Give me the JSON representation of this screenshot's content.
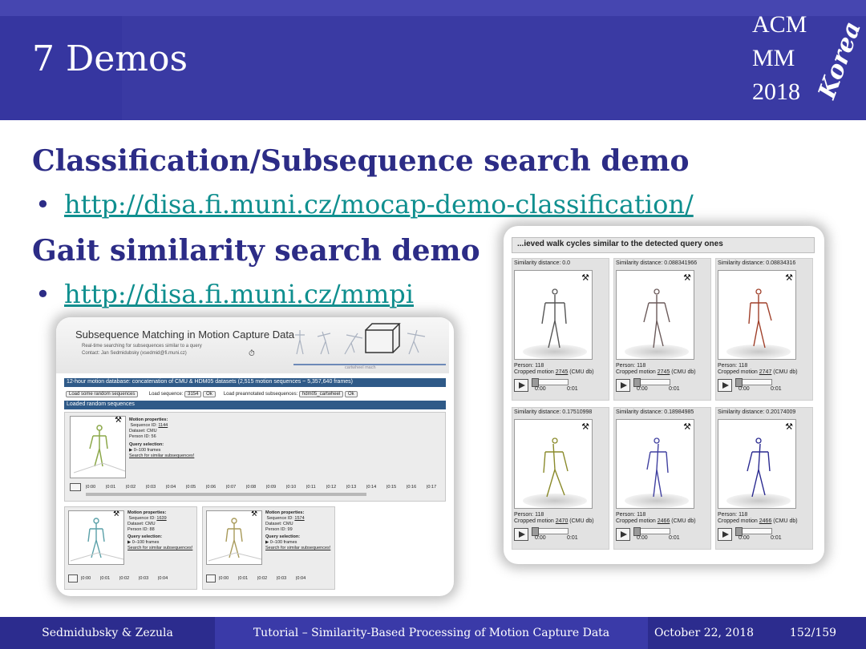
{
  "slide": {
    "title": "7 Demos",
    "logo": {
      "line1": "ACM",
      "line2": "MM",
      "line3": "2018",
      "script": "Korea"
    },
    "section1": {
      "heading": "Classification/Subsequence search demo",
      "link": "http://disa.fi.muni.cz/mocap-demo-classification/"
    },
    "section2": {
      "heading": "Gait similarity search demo",
      "link": "http://disa.fi.muni.cz/mmpi"
    }
  },
  "left_shot": {
    "title": "Subsequence Matching in Motion Capture Data",
    "subtitle": "Real-time searching for subsequences similar to a query",
    "contact": "Contact: Jan Sedmidubsky (xsedmid@fi.muni.cz)",
    "timeline_label": "cartwheel mach",
    "db_bar": "12-hour motion database: concatenation of CMU & HDM05 datasets (2,515 motion sequences ~ 5,357,640 frames)",
    "btn_random": "Load some random sequences",
    "load_seq_label": "Load sequence:",
    "load_seq_value": "3154",
    "ok": "Ok",
    "preannotated_label": "Load preannotated subsequences:",
    "preannotated_value": "hdm05_cartwheel",
    "loaded_bar": "Loaded random sequences",
    "main_seq": {
      "props_label": "Motion properties:",
      "seq_id_label": "Sequence ID:",
      "seq_id": "1144",
      "dataset": "Dataset: CMU",
      "person": "Person ID: 56",
      "query_label": "Query selection:",
      "frames": "0–100 frames",
      "search_link": "Search for similar subsequences!"
    },
    "ticks": [
      "0:00",
      "0:01",
      "0:02",
      "0:03",
      "0:04",
      "0:05",
      "0:06",
      "0:07",
      "0:08",
      "0:09",
      "0:10",
      "0:11",
      "0:12",
      "0:13",
      "0:14",
      "0:15",
      "0:16",
      "0:17"
    ],
    "small_seqs": [
      {
        "seq_id": "1639",
        "dataset": "Dataset: CMU",
        "person": "Person ID: 88",
        "frames": "0–100 frames",
        "ticks": [
          "0:00",
          "0:01",
          "0:02",
          "0:03",
          "0:04"
        ]
      },
      {
        "seq_id": "1574",
        "dataset": "Dataset: CMU",
        "person": "Person ID: 99",
        "frames": "0–100 frames",
        "ticks": [
          "0:00",
          "0:01",
          "0:02",
          "0:03",
          "0:04"
        ]
      }
    ]
  },
  "right_shot": {
    "title": "...ieved walk cycles similar to the detected query ones",
    "cells": [
      {
        "distance": "Similarity distance: 0.0",
        "person": "Person: 118",
        "motion_prefix": "Cropped motion",
        "motion_id": "2745",
        "motion_suffix": "(CMU db)",
        "color": "#555555"
      },
      {
        "distance": "Similarity distance: 0.088341966",
        "person": "Person: 118",
        "motion_prefix": "Cropped motion",
        "motion_id": "2745",
        "motion_suffix": "(CMU db)",
        "color": "#6b5a5a"
      },
      {
        "distance": "Similarity distance: 0.08834316",
        "person": "Person: 118",
        "motion_prefix": "Cropped motion",
        "motion_id": "2747",
        "motion_suffix": "(CMU db)",
        "color": "#a0402a"
      },
      {
        "distance": "Similarity distance: 0.17510998",
        "person": "Person: 118",
        "motion_prefix": "Cropped motion",
        "motion_id": "2470",
        "motion_suffix": "(CMU db)",
        "color": "#8a8a2a"
      },
      {
        "distance": "Similarity distance: 0.18984985",
        "person": "Person: 118",
        "motion_prefix": "Cropped motion",
        "motion_id": "2466",
        "motion_suffix": "(CMU db)",
        "color": "#4040a0"
      },
      {
        "distance": "Similarity distance: 0.20174009",
        "person": "Person: 118",
        "motion_prefix": "Cropped motion",
        "motion_id": "2466",
        "motion_suffix": "(CMU db)",
        "color": "#2a2a90"
      }
    ],
    "time_start": "0:00",
    "time_end": "0:01"
  },
  "footer": {
    "authors": "Sedmidubsky & Zezula",
    "title": "Tutorial – Similarity-Based Processing of Motion Capture Data",
    "date": "October 22, 2018",
    "page": "152/159"
  },
  "colors": {
    "header": "#3a3aa3",
    "heading": "#2c2c86",
    "link": "#0f8f8f",
    "footer": "#2c2c8e"
  }
}
